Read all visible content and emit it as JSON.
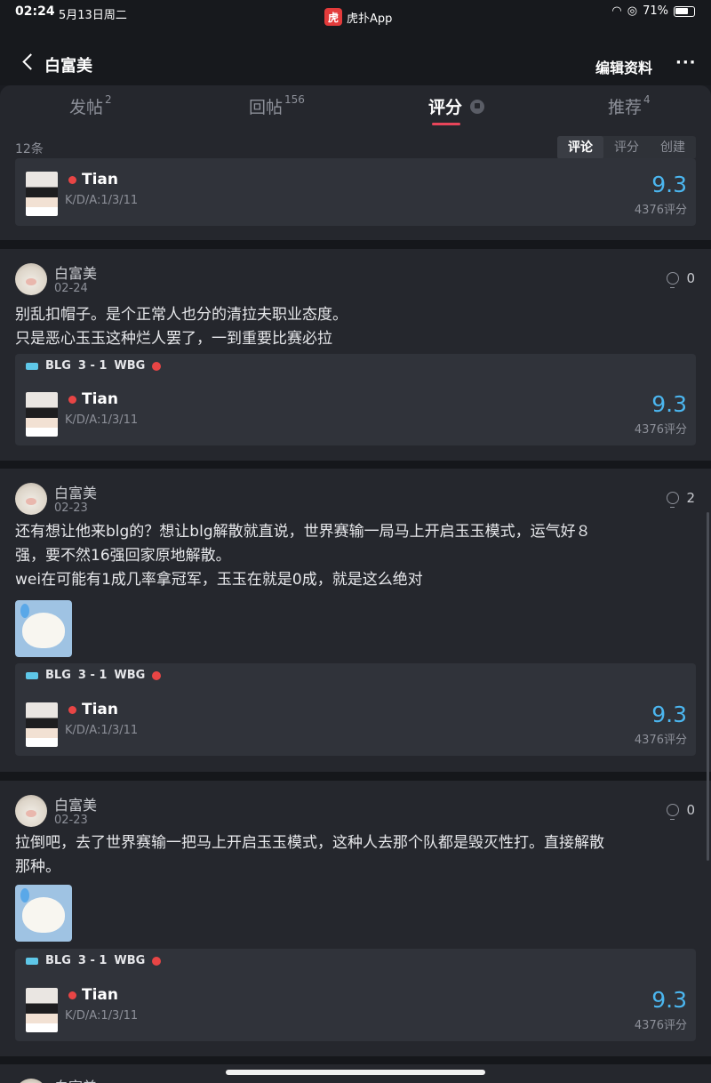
{
  "status_bar": {
    "time": "02:24",
    "date": "5月13日周二",
    "app_name": "虎扑App",
    "battery": "71%"
  },
  "nav": {
    "title": "白富美",
    "edit_label": "编辑资料",
    "more_label": "···"
  },
  "tabs": [
    {
      "label": "发帖",
      "count": "2"
    },
    {
      "label": "回帖",
      "count": "156"
    },
    {
      "label": "评分",
      "count": ""
    },
    {
      "label": "推荐",
      "count": "4"
    }
  ],
  "count_text": "12条",
  "segments": [
    "评论",
    "评分",
    "创建"
  ],
  "rating": {
    "player": "Tian",
    "kda": "K/D/A:1/3/11",
    "score": "9.3",
    "score_count": "4376评分",
    "match": {
      "team_a": "BLG",
      "score": "3 - 1",
      "team_b": "WBG"
    }
  },
  "posts": [
    {
      "user": "白富美",
      "date": "02-24",
      "likes": "0",
      "lines": [
        "别乱扣帽子。是个正常人也分的清拉夫职业态度。",
        "只是恶心玉玉这种烂人罢了，一到重要比赛必拉"
      ]
    },
    {
      "user": "白富美",
      "date": "02-23",
      "likes": "2",
      "lines": [
        "还有想让他来blg的？想让blg解散就直说，世界赛输一局马上开启玉玉模式，运气好８",
        "强，要不然16强回家原地解散。",
        "wei在可能有1成几率拿冠军，玉玉在就是0成，就是这么绝对"
      ]
    },
    {
      "user": "白富美",
      "date": "02-23",
      "likes": "0",
      "lines": [
        "拉倒吧，去了世界赛输一把马上开启玉玉模式，这种人去那个队都是毁灭性打。直接解散",
        "那种。"
      ]
    },
    {
      "user": "白富美",
      "date": "",
      "likes": "",
      "lines": []
    }
  ]
}
